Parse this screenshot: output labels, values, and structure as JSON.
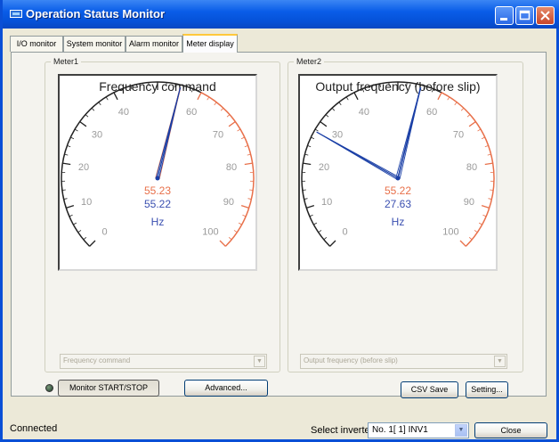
{
  "window": {
    "title": "Operation Status Monitor"
  },
  "title_buttons": {
    "minimize": "minimize-icon",
    "maximize": "maximize-icon",
    "close": "close-icon"
  },
  "tabs": [
    {
      "label": "I/O monitor",
      "active": false
    },
    {
      "label": "System monitor",
      "active": false
    },
    {
      "label": "Alarm monitor",
      "active": false
    },
    {
      "label": "Meter display",
      "active": true
    }
  ],
  "meters": [
    {
      "group_label": "Meter1",
      "title": "Frequency command",
      "scale_labels": [
        "0",
        "10",
        "20",
        "30",
        "40",
        "60",
        "70",
        "80",
        "90",
        "100"
      ],
      "redzone_start": 60,
      "needles": [
        {
          "value": 55.23,
          "color": "#e8704a"
        },
        {
          "value": 55.22,
          "color": "#1a3fa6"
        }
      ],
      "readout_1": "55.23",
      "readout_2": "55.22",
      "unit": "Hz",
      "select_value": "Frequency command"
    },
    {
      "group_label": "Meter2",
      "title": "Output frequency (before slip)",
      "scale_labels": [
        "0",
        "10",
        "20",
        "30",
        "40",
        "60",
        "70",
        "80",
        "90",
        "100"
      ],
      "redzone_start": 60,
      "needles": [
        {
          "value": 55.22,
          "color": "#1a3fa6"
        },
        {
          "value": 27.63,
          "color": "#1a3fa6"
        }
      ],
      "readout_1": "55.22",
      "readout_2": "27.63",
      "unit": "Hz",
      "select_value": "Output frequency (before slip)"
    }
  ],
  "colors": {
    "scale_normal": "#222222",
    "scale_red": "#e8704a",
    "readout_1": "#e8704a",
    "readout_2": "#3a4fb0",
    "unit": "#3a4fb0",
    "label_normal": "#9a9a9a",
    "label_red": "#9a9a9a"
  },
  "buttons": {
    "monitor_start_stop": "Monitor START/STOP",
    "advanced": "Advanced...",
    "csv_save": "CSV Save",
    "setting": "Setting...",
    "close": "Close"
  },
  "status": {
    "text": "Connected"
  },
  "inverter": {
    "label": "Select inverter",
    "value": "No. 1[ 1] INV1"
  }
}
